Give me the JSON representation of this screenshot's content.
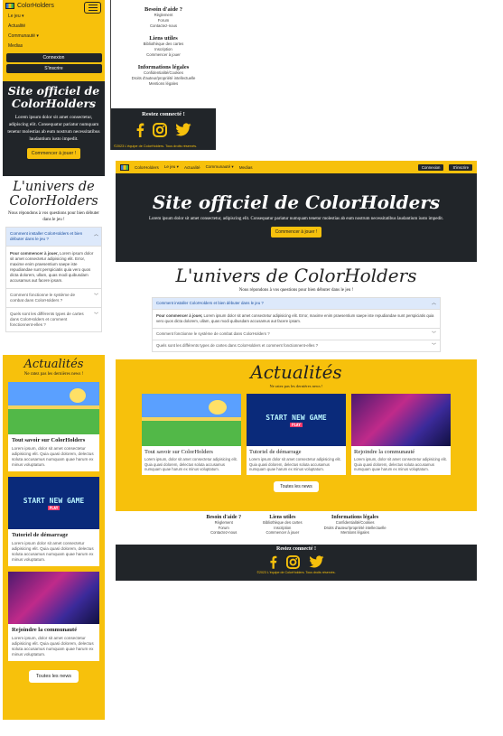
{
  "brand": "ColorHolders",
  "nav": {
    "links": [
      "Le jeu",
      "Actualité",
      "Communauté",
      "Medias"
    ],
    "login": "Connexion",
    "signup": "S'inscrire"
  },
  "hero": {
    "title": "Site officiel de ColorHolders",
    "text": "Lorem ipsum dolor sit amet consectetur, adipiscing elit. Consequatur pariatur numquam tenetur molestias ab eum nostrum necessitatibus laudantium iusto impedit.",
    "cta": "Commencer à jouer !"
  },
  "universe": {
    "title": "L'univers de ColorHolders",
    "subtitle": "Nous répondons à vos questions pour bien débuter dans le jeu !",
    "faq": [
      {
        "q": "Comment installer ColorHolders et bien débuter dans le jeu ?",
        "open": true
      },
      {
        "q": "Comment fonctionne le système de combat dans ColorHolders ?",
        "open": false
      },
      {
        "q": "Quels sont les différents types de cartes dans ColorHolders et comment fonctionnent-elles ?",
        "open": false
      }
    ],
    "answer_lead": "Pour commencer à jouer,",
    "answer": "Lorem ipsum dolor sit amet consectetur adipisicing elit. Error, maxime enim praesentium saepe iste repudiandae sunt perspiciatis quia vero quos dicta dolorem, ullam, quas modi quibusdam accusamus aut facere ipsam."
  },
  "news": {
    "title": "Actualités",
    "subtitle": "Ne ratez pas les dernières news !",
    "cards": [
      {
        "title": "Tout savoir sur ColorHolders",
        "text": "Lorem ipsum, dolor sit amet consectetur adipisicing elit. Quia quasi dolorem, delectus soluta accusamus numquam quae harum ex minus voluptatum."
      },
      {
        "title": "Tutoriel de démarrage",
        "text": "Lorem ipsum dolor sit amet consectetur adipisicing elit. Quia quasi dolorem, delectus soluta accusamus numquam quae harum ex minus voluptatum.",
        "img_text": "START NEW GAME",
        "img_badge": "PLAY"
      },
      {
        "title": "Rejoindre la communauté",
        "text": "Lorem ipsum, dolor sit amet consectetur adipisicing elit. Quia quasi dolorem, delectus soluta accusamus numquam quae harum ex minus voluptatum."
      }
    ],
    "more": "Toutes les news"
  },
  "footer": {
    "help": {
      "title": "Besoin d'aide ?",
      "links": [
        "Règlement",
        "Forum",
        "Contactez-nous"
      ]
    },
    "useful": {
      "title": "Liens utiles",
      "links": [
        "Bibliothèque des cartes",
        "Inscription",
        "Commencer à jouer"
      ]
    },
    "legal": {
      "title": "Informations légales",
      "links": [
        "Confidentialité/Cookies",
        "Droits d'auteur/propriété intellectuelle",
        "Mentions légales"
      ]
    },
    "social_title": "Restez connecté !",
    "copyright": "©2023 L'équipe de ColorHolders. Tous droits réservés."
  },
  "colors": {
    "accent": "#f7c10c",
    "dark": "#212529",
    "faq_open": "#dde9fb"
  }
}
